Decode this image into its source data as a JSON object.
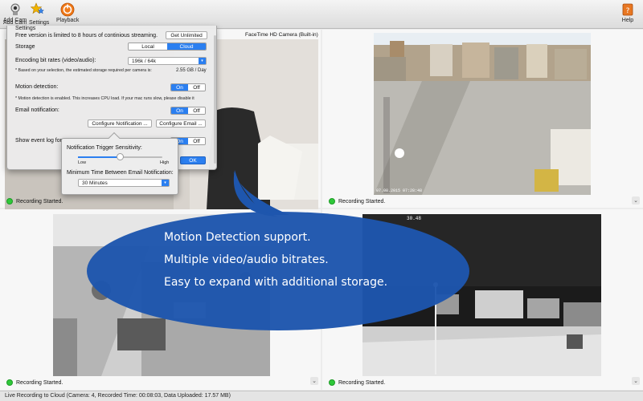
{
  "toolbar": {
    "add_cam": "Add Cam",
    "settings": "Settings",
    "playback": "Playback",
    "help": "Help"
  },
  "settings_panel": {
    "title": "Settings",
    "free_notice": "Free version is limited to 8 hours of continious streaming.",
    "get_unlimited": "Get Unlimited",
    "storage_label": "Storage",
    "storage_options": [
      "Local",
      "Cloud"
    ],
    "storage_selected": "Cloud",
    "bitrate_label": "Encoding bit rates (video/audio):",
    "bitrate_value": "196k / 64k",
    "estimate_note": "* Based on your selection, the estimated storage required per camera is:",
    "estimate_value": "2.55 GB  / Day",
    "motion_label": "Motion detection:",
    "motion_note": "* Motion detection is enabled.  This increases CPU load.  If your mac runs slow, please disable it",
    "email_label": "Email notification:",
    "configure_notification": "Configure Notification ...",
    "configure_email": "Configure Email ...",
    "event_log_label": "Show event log for",
    "on": "On",
    "off": "Off",
    "ok": "OK"
  },
  "notification_popover": {
    "sensitivity_label": "Notification Trigger Sensitivity:",
    "low": "Low",
    "high": "High",
    "sensitivity_value": 0.5,
    "min_time_label": "Minimum Time Between Email Notification:",
    "min_time_value": "30 Minutes"
  },
  "cameras": [
    {
      "title": "FaceTime HD Camera (Built-in)",
      "status": "Recording Started.",
      "timestamp": ""
    },
    {
      "title": "",
      "status": "Recording Started.",
      "timestamp": "07.08.2015 07:28:48"
    },
    {
      "title": "",
      "status": "Recording Started.",
      "timestamp": ""
    },
    {
      "title": "",
      "status": "Recording Started.",
      "timestamp": "30.48"
    }
  ],
  "bubble": {
    "lines": [
      "Motion Detection support.",
      "Multiple video/audio bitrates.",
      "Easy to expand with additional storage."
    ],
    "color": "#1e56ad"
  },
  "status_bar": "Live Recording to Cloud (Camera: 4, Recorded Time: 00:08:03, Data Uploaded: 17.57 MB)",
  "colors": {
    "accent": "#2b7ff0",
    "recording": "#2fc83a"
  }
}
